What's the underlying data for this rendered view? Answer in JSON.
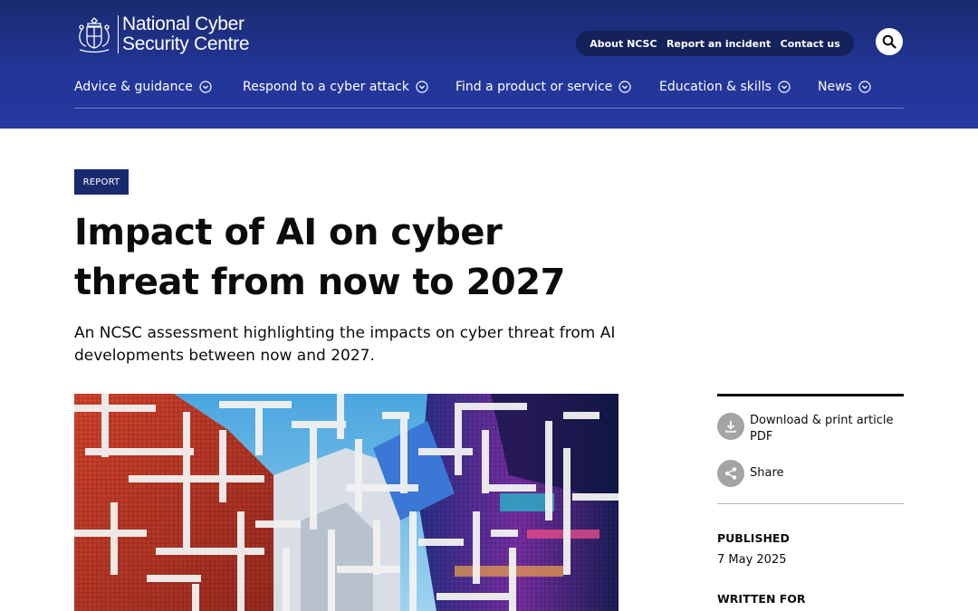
{
  "header": {
    "brand_line1": "National Cyber",
    "brand_line2": "Security Centre",
    "utility_links": [
      "About NCSC",
      "Report an incident",
      "Contact us"
    ],
    "nav": [
      "Advice & guidance",
      "Respond to a cyber attack",
      "Find a product or service",
      "Education & skills",
      "News"
    ],
    "colors": {
      "header_bg": "#223598",
      "utility_bg": "#14215a"
    }
  },
  "article": {
    "tag": "REPORT",
    "title_line1": "Impact of AI on cyber",
    "title_line2": "threat from now to 2027",
    "summary_line1": "An NCSC assessment highlighting the impacts on cyber threat from AI",
    "summary_line2": "developments between now and 2027."
  },
  "sidebar": {
    "download_line1": "Download & print article",
    "download_line2": "PDF",
    "share": "Share",
    "published_label": "PUBLISHED",
    "published_date": "7 May 2025",
    "written_for_label": "WRITTEN FOR"
  },
  "icons": {
    "search": "search-icon",
    "chevron": "chevron-down-icon",
    "download": "download-icon",
    "share": "share-icon",
    "crest": "royal-crest-icon"
  }
}
